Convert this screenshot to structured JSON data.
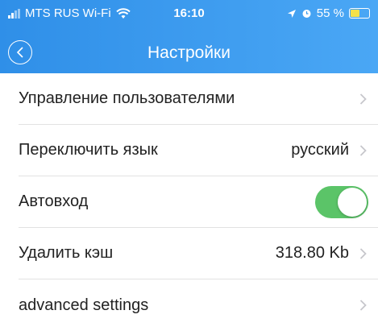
{
  "status_bar": {
    "carrier": "MTS RUS Wi-Fi",
    "time": "16:10",
    "battery_percent": "55 %",
    "battery_level": 0.55,
    "signal_bars": 4
  },
  "nav": {
    "title": "Настройки",
    "back_icon": "chevron-left-circle-icon"
  },
  "settings": [
    {
      "label": "Управление пользователями",
      "value": "",
      "control": "chevron"
    },
    {
      "label": "Переключить язык",
      "value": "русский",
      "control": "chevron"
    },
    {
      "label": "Автовход",
      "value": "",
      "control": "toggle",
      "on": true
    },
    {
      "label": "Удалить кэш",
      "value": "318.80 Kb",
      "control": "chevron"
    },
    {
      "label": "advanced settings",
      "value": "",
      "control": "chevron"
    }
  ],
  "colors": {
    "header_start": "#2f8fe8",
    "header_end": "#4aa7f5",
    "toggle_on": "#5bc468",
    "chevron": "#c7c7cc"
  }
}
